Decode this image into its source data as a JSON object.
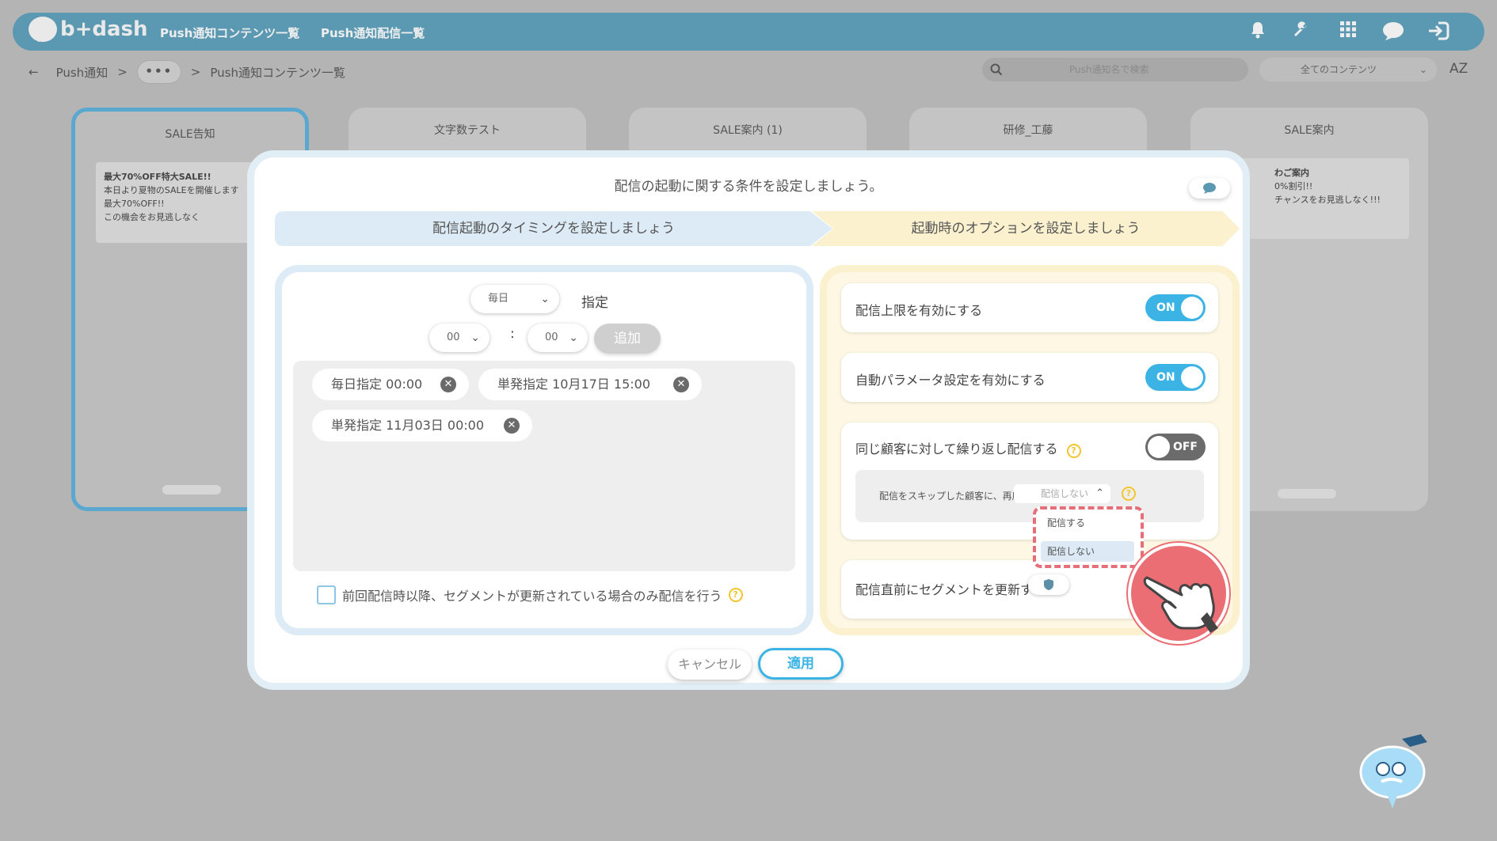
{
  "header": {
    "logo_text": "b+dash",
    "nav_links": [
      "Push通知コンテンツ一覧",
      "Push通知配信一覧"
    ],
    "icons": [
      "bell-icon",
      "wrench-icon",
      "grid-icon",
      "help-bubble-icon",
      "logout-icon"
    ]
  },
  "breadcrumb": {
    "back": "←",
    "root": "Push通知",
    "sep1": ">",
    "ellipsis": "•••",
    "sep2": ">",
    "current": "Push通知コンテンツ一覧"
  },
  "search": {
    "placeholder": "Push通知名で検索"
  },
  "filter": {
    "selected": "全てのコンテンツ"
  },
  "sort_label": "AZ",
  "cards": [
    {
      "title": "SALE告知",
      "lines": [
        "最大70%OFF特大SALE!!",
        "本日より夏物のSALEを開催します",
        "最大70%OFF!!",
        "この機会をお見逃しなく"
      ]
    },
    {
      "title": "文字数テスト",
      "lines": []
    },
    {
      "title": "SALE案内 (1)",
      "lines": []
    },
    {
      "title": "研修_工藤",
      "lines": []
    },
    {
      "title": "SALE案内",
      "lines": [
        "わご案内",
        "0%割引!!",
        "チャンスをお見逃しなく!!!"
      ]
    }
  ],
  "modal": {
    "title": "配信の起動に関する条件を設定しましょう。",
    "step1": "配信起動のタイミングを設定しましょう",
    "step2": "起動時のオプションを設定しましょう",
    "timing": {
      "frequency": "毎日",
      "frequency_suffix": "指定",
      "hour": "00",
      "colon": ":",
      "minute": "00",
      "add_label": "追加",
      "chips": [
        "毎日指定 00:00",
        "単発指定 10月17日 15:00",
        "単発指定 11月03日 00:00"
      ],
      "checkbox_label": "前回配信時以降、セグメントが更新されている場合のみ配信を行う"
    },
    "options": {
      "limit_label": "配信上限を有効にする",
      "limit_state": "ON",
      "auto_param_label": "自動パラメータ設定を有効にする",
      "auto_param_state": "ON",
      "repeat_label": "同じ顧客に対して繰り返し配信する",
      "repeat_state": "OFF",
      "skip_text": "配信をスキップした顧客に、再度",
      "skip_value": "配信しない",
      "dropdown_options": [
        "配信する",
        "配信しない"
      ],
      "segment_label": "配信直前にセグメントを更新する"
    },
    "cancel": "キャンセル",
    "apply": "適用"
  },
  "colors": {
    "accent": "#3bb4e5",
    "nav_bg": "#5b99b3",
    "step1_bg": "#dcebf5",
    "step2_bg": "#fbf1cf",
    "highlight": "#ea6e74"
  }
}
